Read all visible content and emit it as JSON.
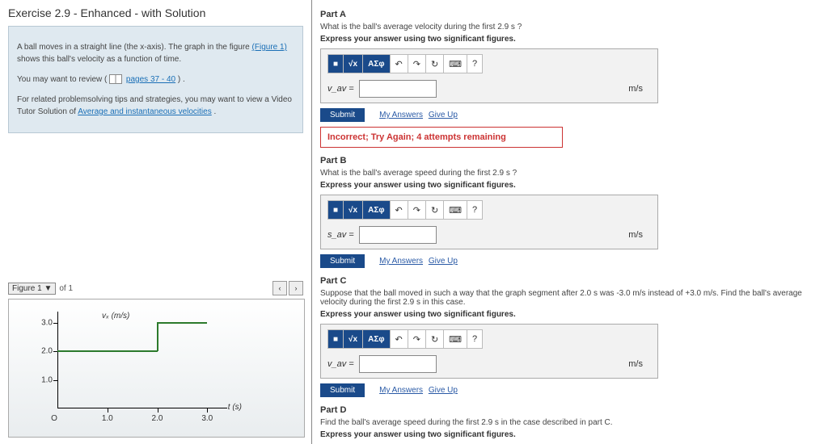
{
  "title": "Exercise 2.9 - Enhanced - with Solution",
  "intro": {
    "l1a": "A ball moves in a straight line (the x-axis). The graph in the figure ",
    "fig_link": "(Figure 1)",
    "l1b": " shows this ball's velocity as a function of time.",
    "l2a": "You may want to review (",
    "pages_link": "pages 37 - 40",
    "l2b": ") .",
    "l3a": "For related problemsolving tips and strategies, you may want to view a Video Tutor Solution of ",
    "vel_link": "Average and instantaneous velocities",
    "l3b": "."
  },
  "fig": {
    "sel": "Figure 1",
    "of": "of 1",
    "prev": "‹",
    "next": "›"
  },
  "chart_data": {
    "type": "line",
    "xlabel": "t (s)",
    "ylabel": "vₓ (m/s)",
    "x": [
      0,
      2.0,
      2.0,
      3.0
    ],
    "y": [
      2.0,
      2.0,
      3.0,
      3.0
    ],
    "xticks": [
      0,
      1.0,
      2.0,
      3.0
    ],
    "xticklabels": [
      "O",
      "1.0",
      "2.0",
      "3.0"
    ],
    "yticks": [
      1.0,
      2.0,
      3.0
    ],
    "yticklabels": [
      "1.0",
      "2.0",
      "3.0"
    ],
    "xlim": [
      0,
      3.4
    ],
    "ylim": [
      0,
      3.4
    ]
  },
  "tools": {
    "t1": "■",
    "t2": "√x",
    "t3": "ΑΣφ",
    "undo": "↶",
    "redo": "↷",
    "reset": "↻",
    "kbd": "⌨",
    "help": "?"
  },
  "partA": {
    "head": "Part A",
    "q": "What is the ball's average velocity during the first 2.9 s ?",
    "instr": "Express your answer using two significant figures.",
    "var": "v_av =",
    "unit": "m/s",
    "submit": "Submit",
    "my": "My Answers",
    "give": "Give Up",
    "fb": "Incorrect; Try Again; 4 attempts remaining"
  },
  "partB": {
    "head": "Part B",
    "q": "What is the ball's average speed during the first 2.9 s ?",
    "instr": "Express your answer using two significant figures.",
    "var": "s_av =",
    "unit": "m/s",
    "submit": "Submit",
    "my": "My Answers",
    "give": "Give Up"
  },
  "partC": {
    "head": "Part C",
    "q": "Suppose that the ball moved in such a way that the graph segment after 2.0 s was -3.0 m/s instead of +3.0 m/s. Find the ball's average velocity during the first 2.9 s in this case.",
    "instr": "Express your answer using two significant figures.",
    "var": "v_av =",
    "unit": "m/s",
    "submit": "Submit",
    "my": "My Answers",
    "give": "Give Up"
  },
  "partD": {
    "head": "Part D",
    "q": "Find the ball's average speed during the first 2.9 s in the case described in part C.",
    "instr": "Express your answer using two significant figures."
  }
}
